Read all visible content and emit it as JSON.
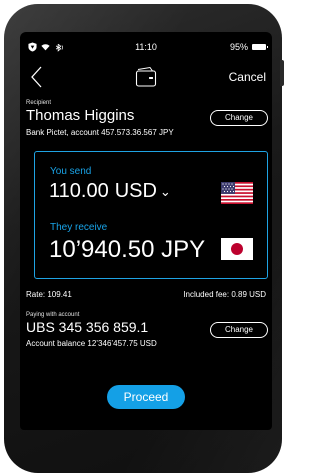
{
  "status_bar": {
    "time": "11:10",
    "battery": "95%"
  },
  "nav": {
    "back_icon": "chevron-left-icon",
    "center_icon": "card-icon",
    "cancel": "Cancel"
  },
  "recipient": {
    "label": "Recipient",
    "name": "Thomas Higgins",
    "bank": "Bank Pictet, account 457.573.36.567 JPY",
    "change": "Change"
  },
  "exchange": {
    "send_label": "You send",
    "send_amount": "110.00",
    "send_currency": "USD",
    "send_flag": "us-flag",
    "receive_label": "They receive",
    "receive_amount": "10’940.50",
    "receive_currency": "JPY",
    "receive_flag": "jp-flag",
    "accent": "#19a4e8"
  },
  "rate": "Rate: 109.41",
  "fee": "Included fee: 0.89 USD",
  "paying": {
    "label": "Paying with account",
    "account": "UBS 345 356 859.1",
    "change": "Change",
    "balance": "Account balance  12’346’457.75 USD"
  },
  "proceed": "Proceed"
}
